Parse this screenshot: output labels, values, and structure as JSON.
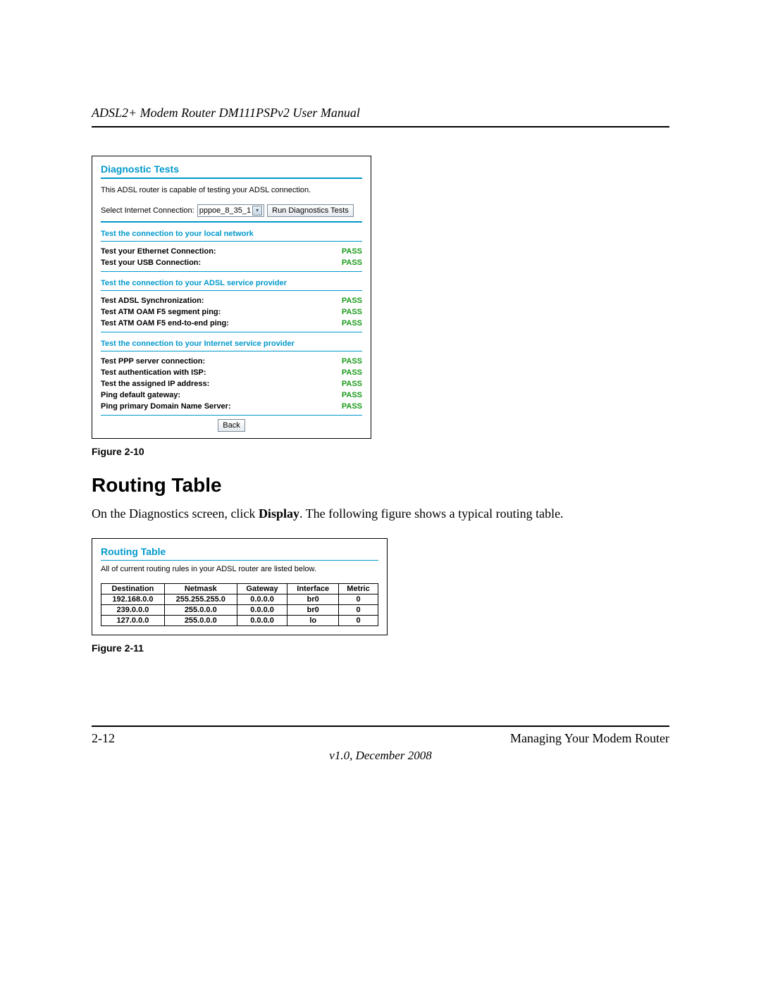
{
  "doc": {
    "header": "ADSL2+ Modem Router DM111PSPv2 User Manual",
    "fig1_caption": "Figure 2-10",
    "section_heading": "Routing Table",
    "body_text_pre": "On the Diagnostics screen, click ",
    "body_text_bold": "Display",
    "body_text_post": ". The following figure shows a typical routing table.",
    "fig2_caption": "Figure 2-11",
    "page_num": "2-12",
    "footer_right": "Managing Your Modem Router",
    "version_line": "v1.0, December 2008"
  },
  "diag": {
    "title": "Diagnostic Tests",
    "desc": "This ADSL router is capable of testing your ADSL connection.",
    "select_label": "Select Internet Connection:",
    "select_value": "pppoe_8_35_1",
    "run_btn": "Run Diagnostics Tests",
    "back_btn": "Back",
    "sec1_title": "Test the connection to your local network",
    "sec1_tests": [
      {
        "label": "Test your Ethernet Connection:",
        "result": "PASS"
      },
      {
        "label": "Test your USB Connection:",
        "result": "PASS"
      }
    ],
    "sec2_title": "Test the connection to your ADSL service provider",
    "sec2_tests": [
      {
        "label": "Test ADSL Synchronization:",
        "result": "PASS"
      },
      {
        "label": "Test ATM OAM F5 segment ping:",
        "result": "PASS"
      },
      {
        "label": "Test ATM OAM F5 end-to-end ping:",
        "result": "PASS"
      }
    ],
    "sec3_title": "Test the connection to your Internet service provider",
    "sec3_tests": [
      {
        "label": "Test PPP server connection:",
        "result": "PASS"
      },
      {
        "label": "Test authentication with ISP:",
        "result": "PASS"
      },
      {
        "label": "Test the assigned IP address:",
        "result": "PASS"
      },
      {
        "label": "Ping default gateway:",
        "result": "PASS"
      },
      {
        "label": "Ping primary Domain Name Server:",
        "result": "PASS"
      }
    ]
  },
  "routing": {
    "title": "Routing Table",
    "desc": "All of current routing rules in your ADSL router are listed below.",
    "headers": [
      "Destination",
      "Netmask",
      "Gateway",
      "Interface",
      "Metric"
    ],
    "rows": [
      [
        "192.168.0.0",
        "255.255.255.0",
        "0.0.0.0",
        "br0",
        "0"
      ],
      [
        "239.0.0.0",
        "255.0.0.0",
        "0.0.0.0",
        "br0",
        "0"
      ],
      [
        "127.0.0.0",
        "255.0.0.0",
        "0.0.0.0",
        "lo",
        "0"
      ]
    ]
  }
}
